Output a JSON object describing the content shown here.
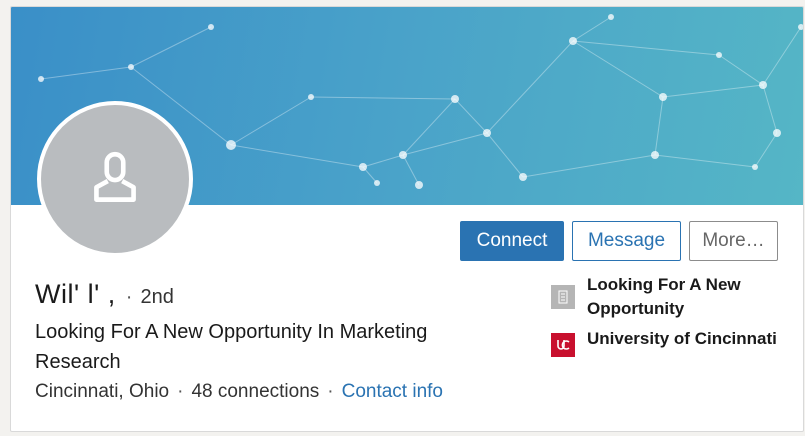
{
  "profile": {
    "name": "Wil'    l'   ,",
    "separator": "·",
    "degree": "2nd",
    "headline": "Looking For A New Opportunity In Marketing Research",
    "location": "Cincinnati, Ohio",
    "connections": "48 connections",
    "contact_info": "Contact info"
  },
  "actions": {
    "connect": "Connect",
    "message": "Message",
    "more": "More…"
  },
  "side": {
    "current": "Looking For A New Opportunity",
    "education": "University of Cincinnati",
    "current_icon": "company-placeholder-icon",
    "education_icon": "university-logo-icon"
  },
  "colors": {
    "accent": "#2a73b2",
    "banner_start": "#3a8fc8",
    "banner_end": "#55b6c6",
    "uc_red": "#c8102e"
  }
}
